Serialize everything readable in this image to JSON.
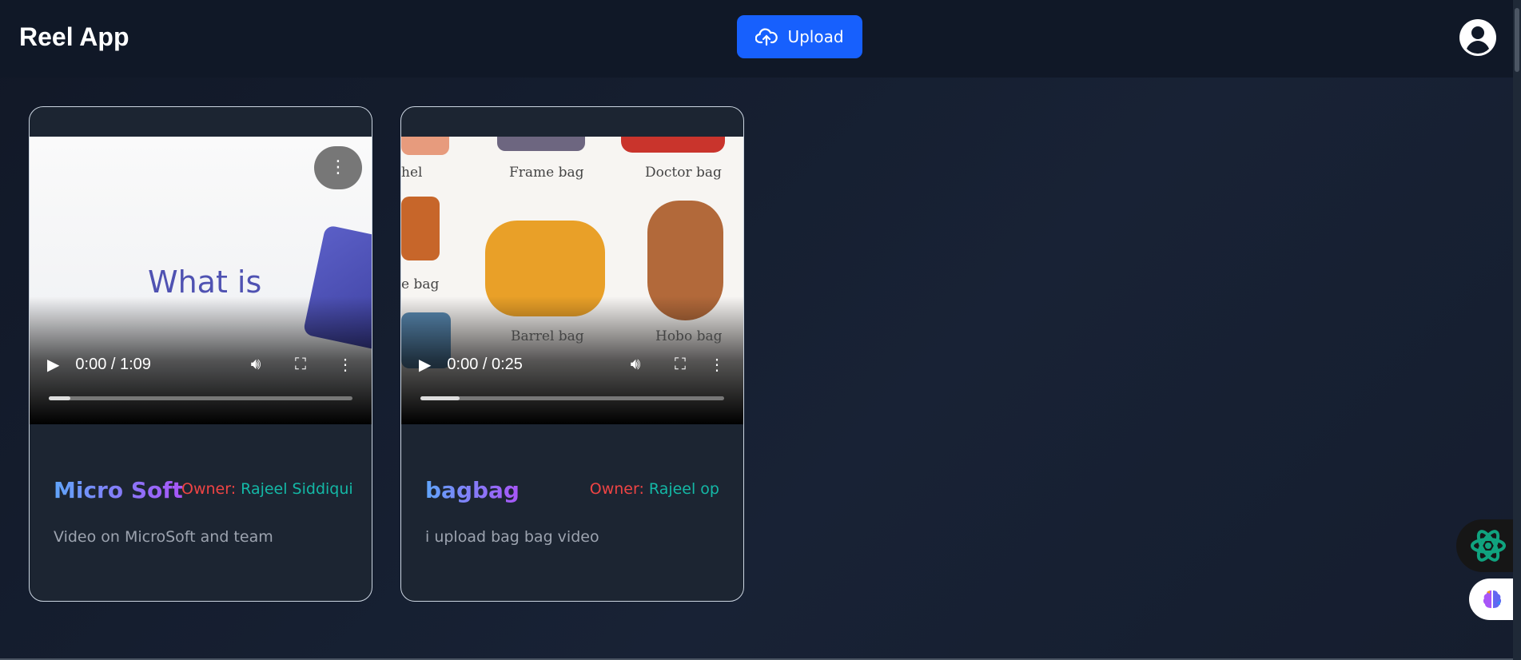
{
  "header": {
    "title": "Reel App",
    "upload_label": "Upload"
  },
  "videos": [
    {
      "title": "Micro Soft",
      "owner_label": "Owner:",
      "owner_name": "Rajeel Siddiqui",
      "description": "Video on MicroSoft and team",
      "time": "0:00 / 1:09",
      "frame_text": "What is",
      "progress": 0.07
    },
    {
      "title": "bagbag",
      "owner_label": "Owner:",
      "owner_name": "Rajeel op",
      "description": "i upload bag bag video",
      "time": "0:00 / 0:25",
      "frame_labels": [
        "hel",
        "Frame bag",
        "Doctor bag",
        "e bag",
        "Barrel bag",
        "Hobo bag"
      ],
      "progress": 0.13
    }
  ],
  "colors": {
    "accent": "#1760fd",
    "owner_label": "#ef4444",
    "owner_name": "#14b8a6"
  }
}
